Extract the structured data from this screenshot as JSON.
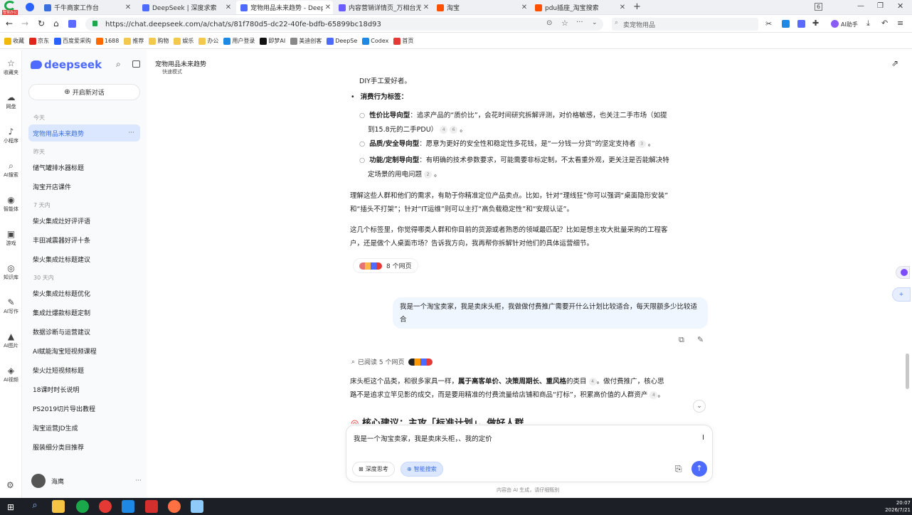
{
  "browser": {
    "logo_badge": "智慧办公",
    "tabs": [
      {
        "label": "千牛商家工作台",
        "color": "#3b6fe0"
      },
      {
        "label": "DeepSeek | 深度求索",
        "color": "#4d6bfe"
      },
      {
        "label": "宠物用品未来趋势 - DeepSe",
        "color": "#4d6bfe"
      },
      {
        "label": "内容营销详情页_万相台无界",
        "color": "#6b5cff"
      },
      {
        "label": "淘宝",
        "color": "#ff5000"
      },
      {
        "label": "pdu插座_淘宝搜索",
        "color": "#ff5000"
      }
    ],
    "url": "https://chat.deepseek.com/a/chat/s/81f780d5-dc22-40fe-bdfb-65899bc18d93",
    "search_placeholder": "卖宠物用品",
    "tab_count": "6",
    "ai_assistant": "AI助手"
  },
  "bookmarks": [
    {
      "label": "收藏",
      "color": "#f2b90d"
    },
    {
      "label": "京东",
      "color": "#e1251b"
    },
    {
      "label": "百度爱采购",
      "color": "#2a62ff"
    },
    {
      "label": "1688",
      "color": "#ff6a00"
    },
    {
      "label": "推荐",
      "color": "#f2c94c"
    },
    {
      "label": "购物",
      "color": "#f2c94c"
    },
    {
      "label": "娱乐",
      "color": "#f2c94c"
    },
    {
      "label": "办公",
      "color": "#f2c94c"
    },
    {
      "label": "用户登录",
      "color": "#1e88e5"
    },
    {
      "label": "即梦AI",
      "color": "#111111"
    },
    {
      "label": "美迪创客",
      "color": "#888888"
    },
    {
      "label": "DeepSe",
      "color": "#4d6bfe"
    },
    {
      "label": "Codex",
      "color": "#1e88e5"
    },
    {
      "label": "首页",
      "color": "#e53935"
    }
  ],
  "rail": [
    {
      "label": "收藏夹",
      "icon": "star-icon",
      "glyph": "☆"
    },
    {
      "label": "网盘",
      "icon": "cloud-icon",
      "glyph": "☁"
    },
    {
      "label": "小程序",
      "icon": "music-note-icon",
      "glyph": "♪"
    },
    {
      "label": "AI搜索",
      "icon": "search-icon",
      "glyph": "⌕"
    },
    {
      "label": "智能体",
      "icon": "bot-icon",
      "glyph": "◉"
    },
    {
      "label": "游戏",
      "icon": "gamepad-icon",
      "glyph": "▣"
    },
    {
      "label": "知识库",
      "icon": "target-icon",
      "glyph": "◎"
    },
    {
      "label": "AI写作",
      "icon": "pen-icon",
      "glyph": "✎"
    },
    {
      "label": "AI图片",
      "icon": "image-icon",
      "glyph": "▲"
    },
    {
      "label": "AI视频",
      "icon": "video-icon",
      "glyph": "◈"
    }
  ],
  "sidebar": {
    "brand": "deepseek",
    "new_chat": "开启新对话",
    "sections": [
      {
        "title": "今天",
        "items": [
          "宠物用品未来趋势"
        ]
      },
      {
        "title": "昨天",
        "items": [
          "储气罐排水器标题",
          "淘宝开店课件"
        ]
      },
      {
        "title": "7 天内",
        "items": [
          "柴火集成灶好评评语",
          "丰田减震器好评十条",
          "柴火集成灶标题建议"
        ]
      },
      {
        "title": "30 天内",
        "items": [
          "柴火集成灶标题优化",
          "集成灶爆款标题定制",
          "数据诊断与运营建议",
          "AI赋能淘宝短视频课程",
          "柴火灶短视频标题",
          "18课时时长说明",
          "PS2019切片导出教程",
          "淘宝运营JD生成",
          "服装细分类目推荐"
        ]
      }
    ],
    "more": "···",
    "user": "海鹰"
  },
  "chat": {
    "title": "宠物用品未来趋势",
    "mode": "快速模式",
    "line_top": "DIY手工爱好者。",
    "consumer_tag_heading": "消费行为标签",
    "bullets": [
      {
        "bold": "性价比导向型",
        "text": "：追求产品的“质价比”，会花时间研究拆解评测，对价格敏感，也关注二手市场（如提",
        "line2": "到15.8元的二手PDU）",
        "cites": [
          "4",
          "6"
        ]
      },
      {
        "bold": "品质/安全导向型",
        "text": "：愿意为更好的安全性和稳定性多花钱，是“一分钱一分货”的坚定支持者",
        "cites": [
          "3"
        ]
      },
      {
        "bold": "功能/定制导向型",
        "text": "：有明确的技术参数要求，可能需要非标定制，不太看重外观，更关注是否能解决特",
        "line2": "定场景的用电问题",
        "cites": [
          "2"
        ]
      }
    ],
    "para1": "理解这些人群和他们的需求，有助于你精准定位产品卖点。比如，针对“理线狂”你可以强调“桌面隐形安装”",
    "para1b": "和“插头不打架”；针对“IT运维”则可以主打“高负载稳定性”和“安规认证”。",
    "para2": "这几个标签里，你觉得哪类人群和你目前的货源或者熟悉的领域最匹配？比如是想主攻大批量采购的工程客",
    "para2b": "户，还是做个人桌面市场？告诉我方向，我再帮你拆解针对他们的具体运营细节。",
    "sources": "8 个网页",
    "user_message": "我是一个淘宝卖家，我是卖床头柜，我做做付费推广需要开什么计划比较适合，每天限额多少比较适合",
    "read_pages": "已阅读 5 个网页",
    "answer_a": "床头柜这个品类，和很多家具一样，",
    "answer_b": "属于",
    "answer_bold": "高客单价、决策周期长、重风格",
    "answer_c": "的类目",
    "answer_c_cite": "4",
    "answer_d": "。做付费推广，核心思",
    "answer2": "路不是追求立竿见影的成交，而是要用精准的付费流量给店铺和商品“打标”，积累高价值的人群资产",
    "answer2_cite": "4",
    "answer2_end": "。",
    "core_heading": "核心建议：主攻「标准计划」，做好人群",
    "input_text": "我是一个淘宝卖家，我是卖床头柜，、我的定价",
    "deep_think": "深度思考",
    "smart_search": "智能搜索",
    "footer": "内容由 AI 生成，请仔细甄别"
  },
  "taskbar": {
    "time": "20:07",
    "date": "2026/7/21"
  }
}
